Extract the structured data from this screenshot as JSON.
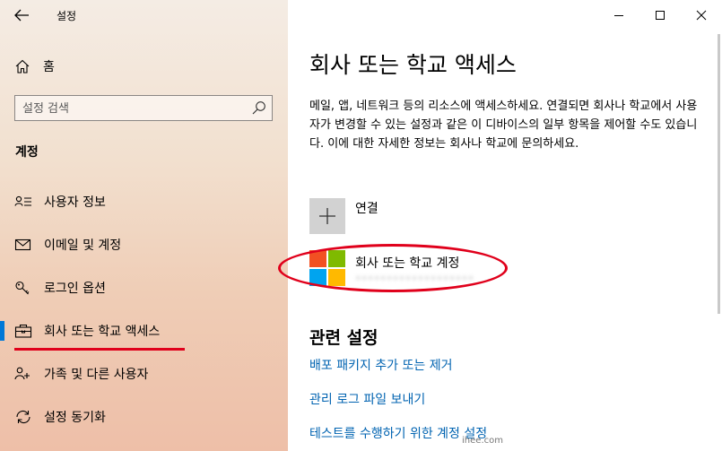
{
  "window": {
    "title": "설정",
    "minimize_glyph": "—",
    "maximize_glyph": "☐",
    "close_glyph": "✕"
  },
  "sidebar": {
    "home_label": "홈",
    "search_placeholder": "설정 검색",
    "section_title": "계정",
    "items": [
      {
        "label": "사용자 정보",
        "icon": "user-info-icon"
      },
      {
        "label": "이메일 및 계정",
        "icon": "mail-icon"
      },
      {
        "label": "로그인 옵션",
        "icon": "key-icon"
      },
      {
        "label": "회사 또는 학교 액세스",
        "icon": "briefcase-icon",
        "active": true
      },
      {
        "label": "가족 및 다른 사용자",
        "icon": "people-icon"
      },
      {
        "label": "설정 동기화",
        "icon": "sync-icon"
      }
    ]
  },
  "main": {
    "title": "회사 또는 학교 액세스",
    "description": "메일, 앱, 네트워크 등의 리소스에 액세스하세요. 연결되면 회사나 학교에서 사용자가 변경할 수 있는 설정과 같은 이 디바이스의 일부 항목을 제어할 수도 있습니다. 이에 대한 자세한 정보는 회사나 학교에 문의하세요.",
    "connect_label": "연결",
    "account": {
      "title": "회사 또는 학교 계정",
      "email": "•••••••••••••••••••"
    },
    "related_title": "관련 설정",
    "links": [
      "배포 패키지 추가 또는 제거",
      "관리 로그 파일 보내기",
      "테스트를 수행하기 위한 계정 설정"
    ]
  },
  "colors": {
    "accent": "#0078d7",
    "link": "#0063b1",
    "annotation_red": "#e0001b",
    "ms_red": "#f25022",
    "ms_green": "#7fba00",
    "ms_blue": "#00a4ef",
    "ms_yellow": "#ffb900"
  },
  "watermark": "ihee.com"
}
